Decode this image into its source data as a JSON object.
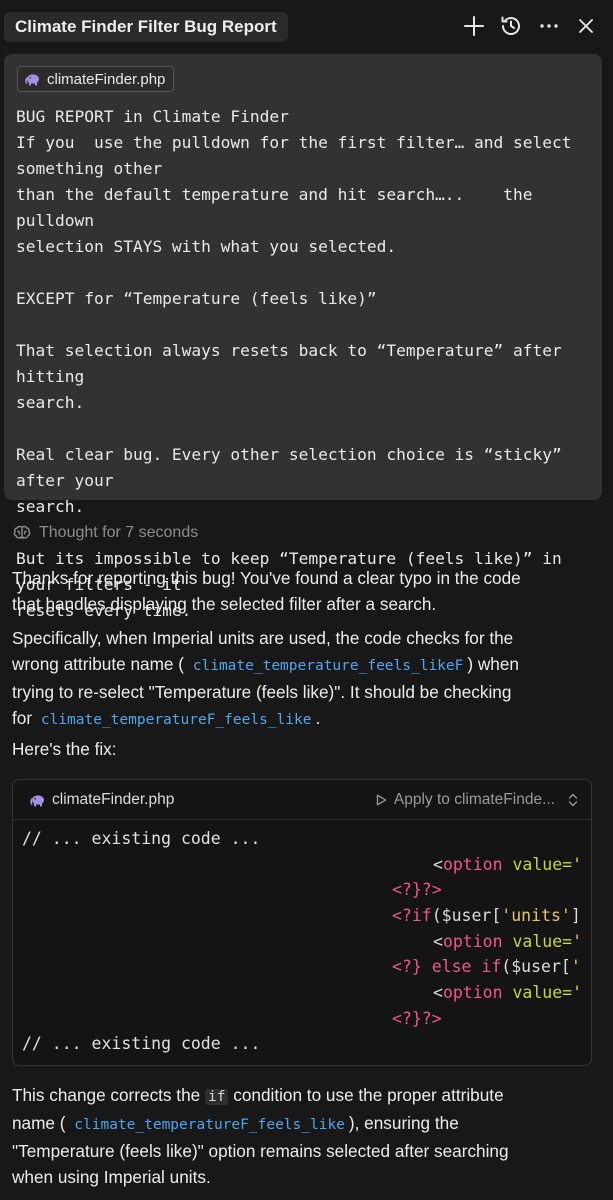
{
  "header": {
    "title": "Climate Finder Filter Bug Report",
    "icons": [
      "plus-icon",
      "history-icon",
      "more-icon",
      "close-icon"
    ]
  },
  "user_message": {
    "attachment": "climateFinder.php",
    "lines": [
      "BUG REPORT in Climate Finder",
      "If you  use the pulldown for the first filter… and select something other",
      "than the default temperature and hit search…..    the pulldown",
      "selection STAYS with what you selected.",
      "",
      "EXCEPT for “Temperature (feels like)”",
      "",
      "That selection always resets back to “Temperature” after hitting",
      "search.",
      "",
      "Real clear bug. Every other selection choice is “sticky” after your",
      "search.",
      "",
      "But its impossible to keep “Temperature (feels like)” in your filters - it",
      "resets every time."
    ]
  },
  "thought": {
    "label": "Thought for 7 seconds"
  },
  "assistant": {
    "p1_line1": "Thanks for reporting this bug! You've found a clear typo in the code",
    "p1_line2": "that handles displaying the selected filter after a search.",
    "p2_line1": "Specifically, when Imperial units are used, the code checks for the",
    "p2_line2_a": "wrong attribute name (",
    "p2_code1": "climate_temperature_feels_likeF",
    "p2_line2_b": ") when",
    "p2_line3": "trying to re-select \"Temperature (feels like)\". It should be checking",
    "p2_line4_a": "for",
    "p2_code2": "climate_temperatureF_feels_like",
    "p2_line4_b": ".",
    "p3": "Here's the fix:",
    "p4_line1_a": "This change corrects the",
    "p4_code_if": "if",
    "p4_line1_b": "condition to use the proper attribute",
    "p4_line2_a": "name (",
    "p4_code": "climate_temperatureF_feels_like",
    "p4_line2_b": "), ensuring the",
    "p4_line3": "\"Temperature (feels like)\" option remains selected after searching",
    "p4_line4": "when using Imperial units."
  },
  "code_block": {
    "filename": "climateFinder.php",
    "apply_label": "Apply to climateFinde...",
    "comment_top": "// ... existing code ...",
    "comment_bottom": "// ... existing code ...",
    "open_bracket": "<",
    "option_tag": "option",
    "value_attr": "value=",
    "quote": "'",
    "close_php1": "<?}?>",
    "php_open": "<?",
    "if_kw": "if",
    "if_args": "($user[",
    "units_str": "'units'",
    "bracket_close": "]",
    "php_close_brace": "<?}",
    "else_if": " else if",
    "else_args": "($user[",
    "close_php2": "<?}?>"
  }
}
